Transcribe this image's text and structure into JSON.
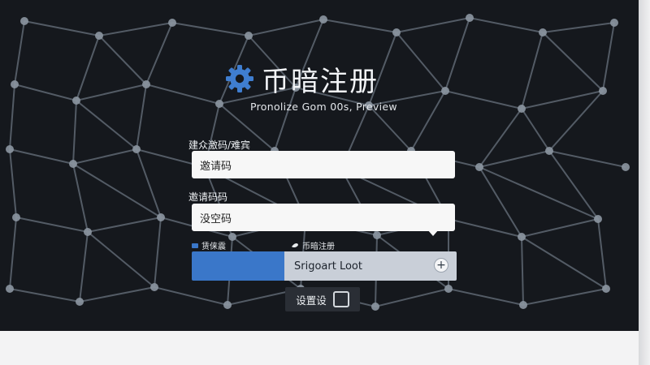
{
  "brand": {
    "title": "币暗注册",
    "subtitle": "Pronolize Gom 00s, Preview"
  },
  "form": {
    "field1_label": "建众激码/难宾",
    "field1_value": "邀请码",
    "field2_label": "邀请码码",
    "field2_value": "没空码"
  },
  "row": {
    "left_text": "赁俫震",
    "right_text": "币暗注册"
  },
  "bar": {
    "button_text": "Srigoart Loot",
    "plus": "+"
  },
  "settings": {
    "label": "设置设"
  },
  "colors": {
    "accent": "#3a77c9",
    "background": "#15181d"
  }
}
